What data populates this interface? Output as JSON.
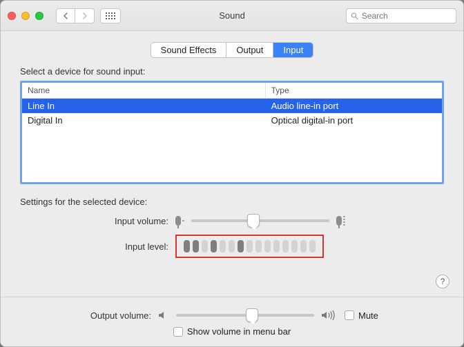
{
  "window": {
    "title": "Sound"
  },
  "search": {
    "placeholder": "Search"
  },
  "colors": {
    "close": "#ff5f57",
    "min": "#febc2e",
    "max": "#28c840",
    "selection": "#2563eb",
    "tab_active": "#3b82f6",
    "highlight_box": "#d33"
  },
  "tabs": [
    {
      "label": "Sound Effects",
      "active": false
    },
    {
      "label": "Output",
      "active": false
    },
    {
      "label": "Input",
      "active": true
    }
  ],
  "section_heading": "Select a device for sound input:",
  "columns": {
    "name": "Name",
    "type": "Type"
  },
  "devices": [
    {
      "name": "Line In",
      "type": "Audio line-in port",
      "selected": true
    },
    {
      "name": "Digital In",
      "type": "Optical digital-in port",
      "selected": false
    }
  ],
  "settings_heading": "Settings for the selected device:",
  "input_volume": {
    "label": "Input volume:",
    "value": 0.45
  },
  "input_level": {
    "label": "Input level:",
    "segments": 15,
    "active": [
      true,
      true,
      false,
      true,
      false,
      false,
      true,
      false,
      false,
      false,
      false,
      false,
      false,
      false,
      false
    ]
  },
  "output_volume": {
    "label": "Output volume:",
    "value": 0.55
  },
  "mute": {
    "label": "Mute",
    "checked": false
  },
  "show_volume": {
    "label": "Show volume in menu bar",
    "checked": false
  },
  "help": {
    "label": "?"
  }
}
